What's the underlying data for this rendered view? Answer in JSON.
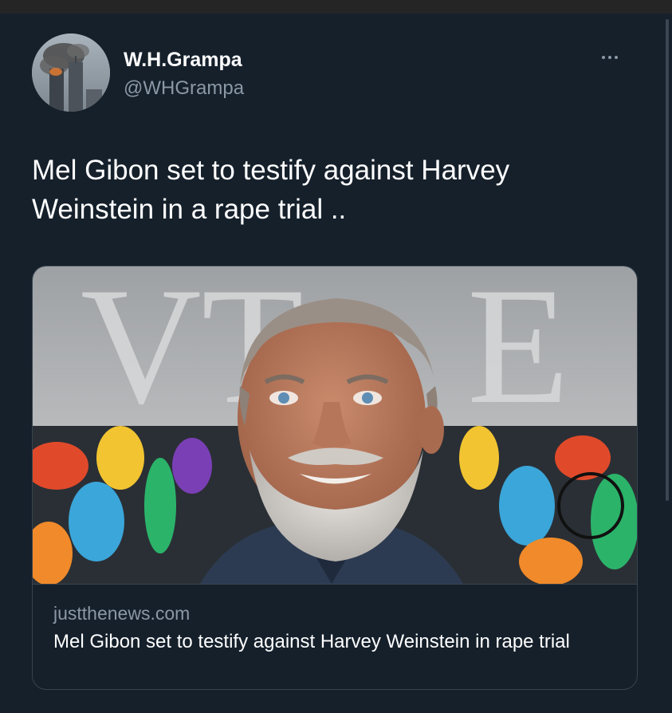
{
  "tweet": {
    "author_name": "W.H.Grampa",
    "author_handle": "@WHGrampa",
    "text": "Mel Gibon set to testify against Harvey Weinstein in a rape trial ..",
    "avatar_icon": "twin-towers-avatar",
    "more_icon": "more-options-icon"
  },
  "card": {
    "domain": "justthenews.com",
    "title": "Mel Gibon set to testify against Harvey Weinstein in rape trial",
    "image_icon": "man-portrait-photo"
  },
  "colors": {
    "background": "#15202b",
    "secondary_text": "#8b98a5",
    "border": "#38444d"
  }
}
